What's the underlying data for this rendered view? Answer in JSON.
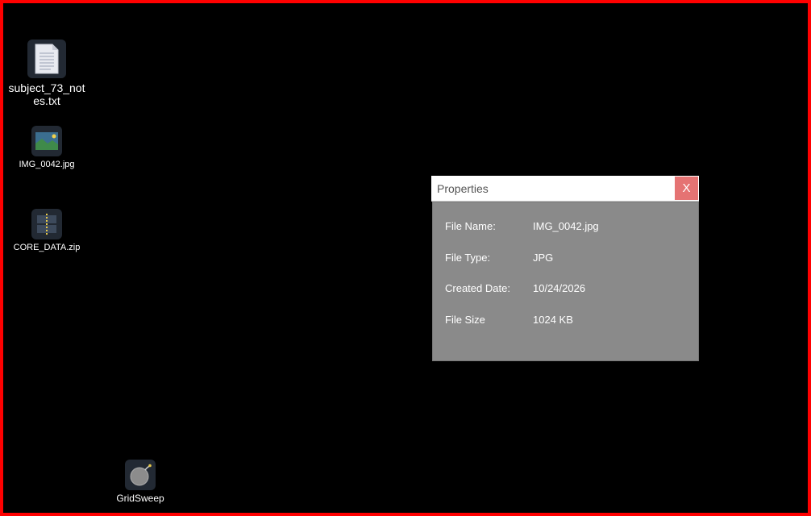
{
  "desktop": {
    "border_color": "#ff0000",
    "icons": [
      {
        "label": "subject_73_notes.txt",
        "icon": "text-file-icon"
      },
      {
        "label": "IMG_0042.jpg",
        "icon": "image-file-icon"
      },
      {
        "label": "CORE_DATA.zip",
        "icon": "zip-file-icon"
      },
      {
        "label": "GridSweep",
        "icon": "bomb-icon"
      }
    ]
  },
  "properties": {
    "title": "Properties",
    "close_label": "X",
    "rows": [
      {
        "key": "File Name:",
        "value": "IMG_0042.jpg"
      },
      {
        "key": "File Type:",
        "value": "JPG"
      },
      {
        "key": "Created Date:",
        "value": "10/24/2026"
      },
      {
        "key": "File Size",
        "value": "1024 KB"
      }
    ]
  }
}
